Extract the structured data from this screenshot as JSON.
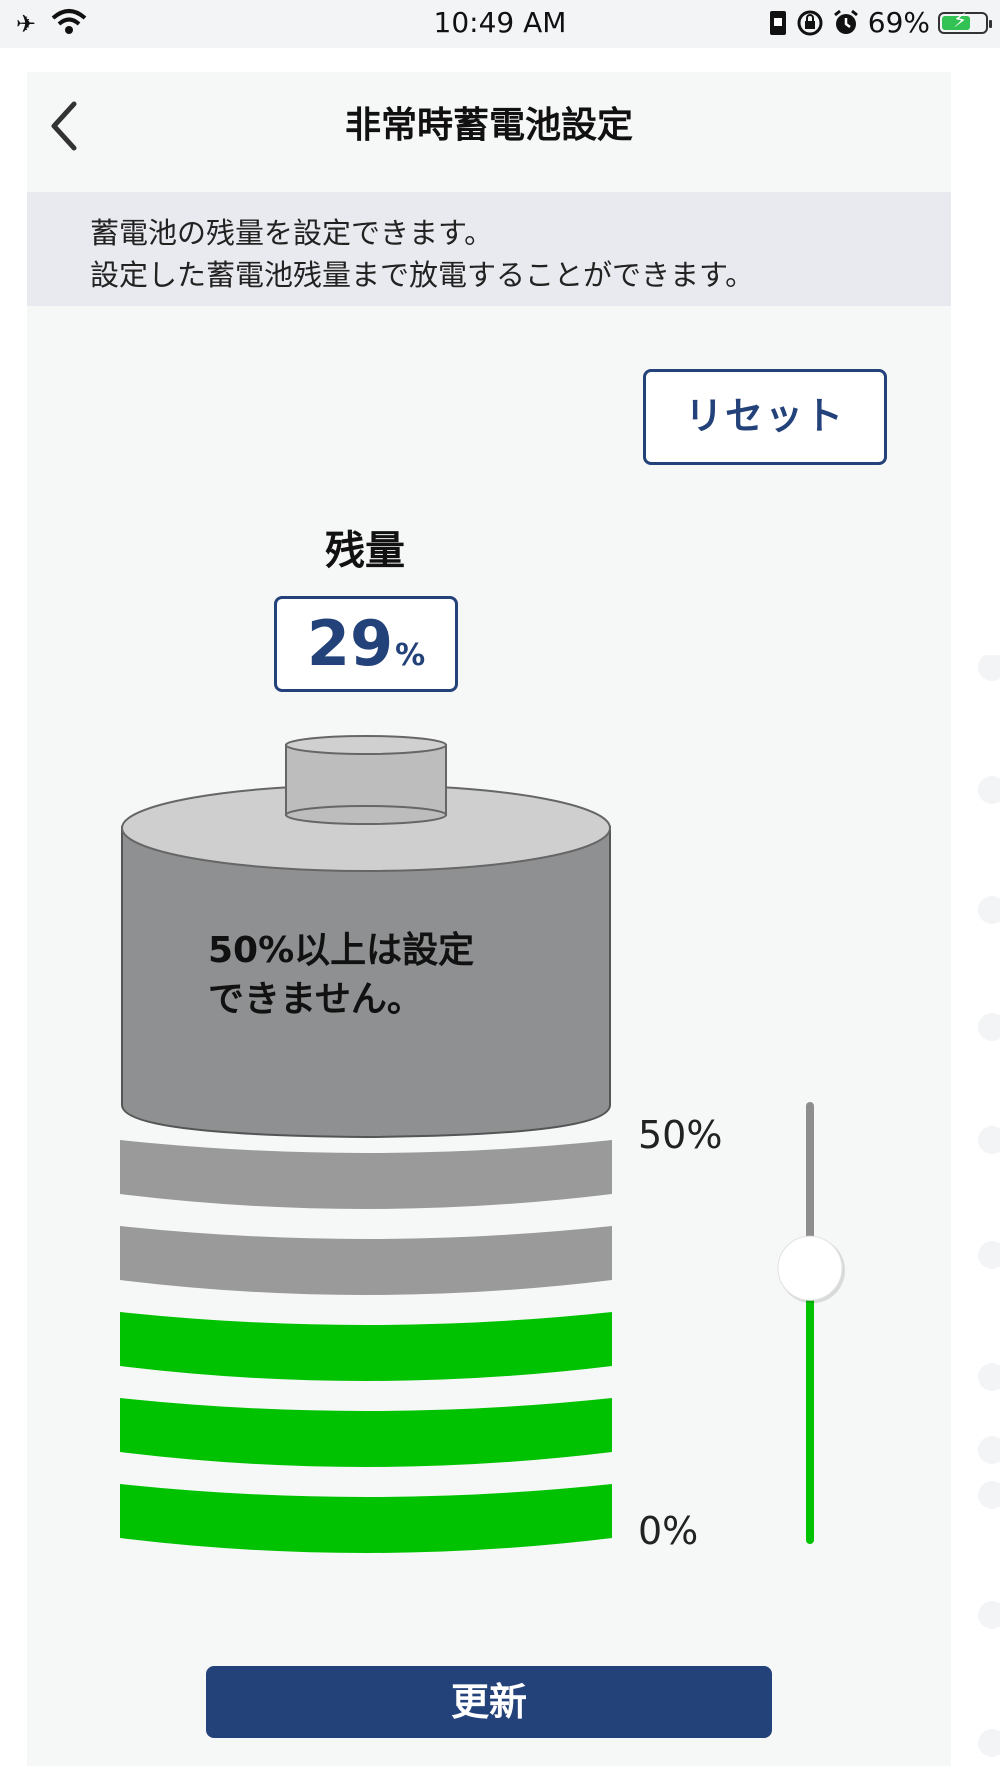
{
  "status_bar": {
    "time": "10:49 AM",
    "battery_percent_text": "69%",
    "battery_level": 0.69,
    "left_icons": [
      "airplane-icon",
      "wifi-icon"
    ],
    "right_icons": [
      "portrait-lock-icon",
      "rotation-lock-icon",
      "alarm-icon",
      "battery-charging-icon"
    ]
  },
  "header": {
    "title": "非常時蓄電池設定"
  },
  "description": {
    "line1": "蓄電池の残量を設定できます。",
    "line2": "設定した蓄電池残量まで放電することができます。"
  },
  "reset_button": {
    "label": "リセット"
  },
  "remaining": {
    "label": "残量",
    "value": "29",
    "unit": "%"
  },
  "battery_graphic": {
    "disabled_note_line1": "50%以上は設定",
    "disabled_note_line2": "できません。",
    "segments_total": 5,
    "segments_filled": 3,
    "colors": {
      "filled": "#00c200",
      "empty": "#9a9a9a",
      "locked_top": "#8f9091"
    }
  },
  "slider": {
    "max_label": "50%",
    "min_label": "0%",
    "value_percent": 29,
    "max_percent": 50,
    "colors": {
      "active": "#00c200",
      "inactive": "#8e8e8e",
      "thumb": "#ffffff"
    }
  },
  "update_button": {
    "label": "更新"
  },
  "theme": {
    "navy": "#24427a",
    "card_bg": "#f6f7f7",
    "desc_bg": "#e9eaef"
  }
}
